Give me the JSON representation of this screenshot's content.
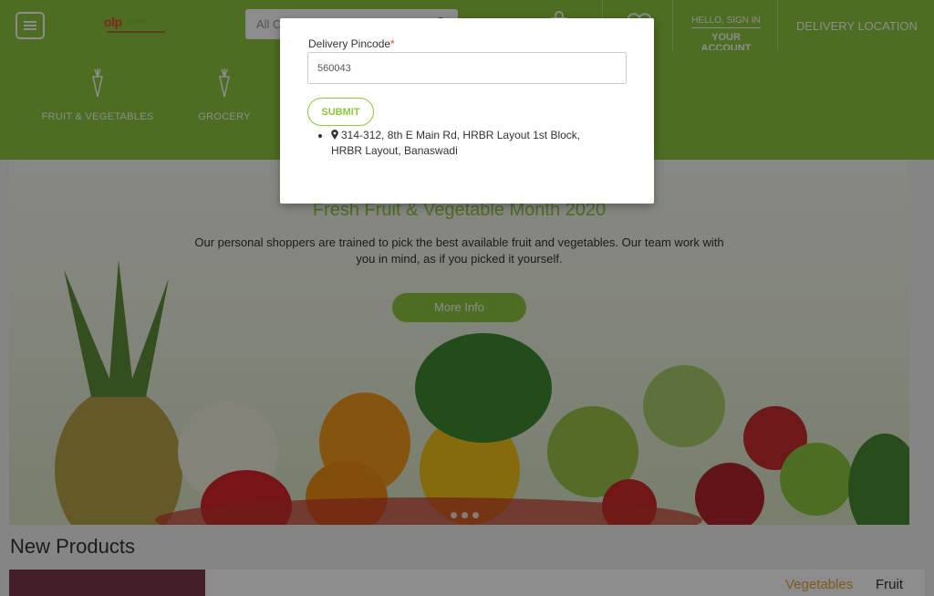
{
  "header": {
    "search_placeholder": "All C",
    "account_hello": "HELLO, SIGN IN",
    "account_main": "YOUR ACCOUNT",
    "delivery_location": "DELIVERY LOCATION",
    "logo_text": "olp",
    "logo_sub": "store"
  },
  "categories": [
    {
      "label": "FRUIT & VEGETABLES",
      "icon": "carrot-icon"
    },
    {
      "label": "GROCERY",
      "icon": "carrot-icon"
    }
  ],
  "hero": {
    "title": "Fresh Fruit & Vegetable Month 2020",
    "text": "Our personal shoppers are trained to pick the best available fruit and vegetables. Our team work with you in mind, as if you picked it yourself.",
    "button": "More Info"
  },
  "new_products": {
    "title": "New Products",
    "tabs": [
      "Vegetables",
      "Fruit"
    ]
  },
  "modal": {
    "label": "Delivery Pincode",
    "required_mark": "*",
    "pincode_value": "560043",
    "submit": "SUBMIT",
    "addresses": [
      "314-312, 8th E Main Rd, HRBR Layout 1st Block, HRBR Layout, Banaswadi"
    ]
  },
  "colors": {
    "brand_green": "#8dc63f",
    "accent_orange": "#e8a13c"
  }
}
